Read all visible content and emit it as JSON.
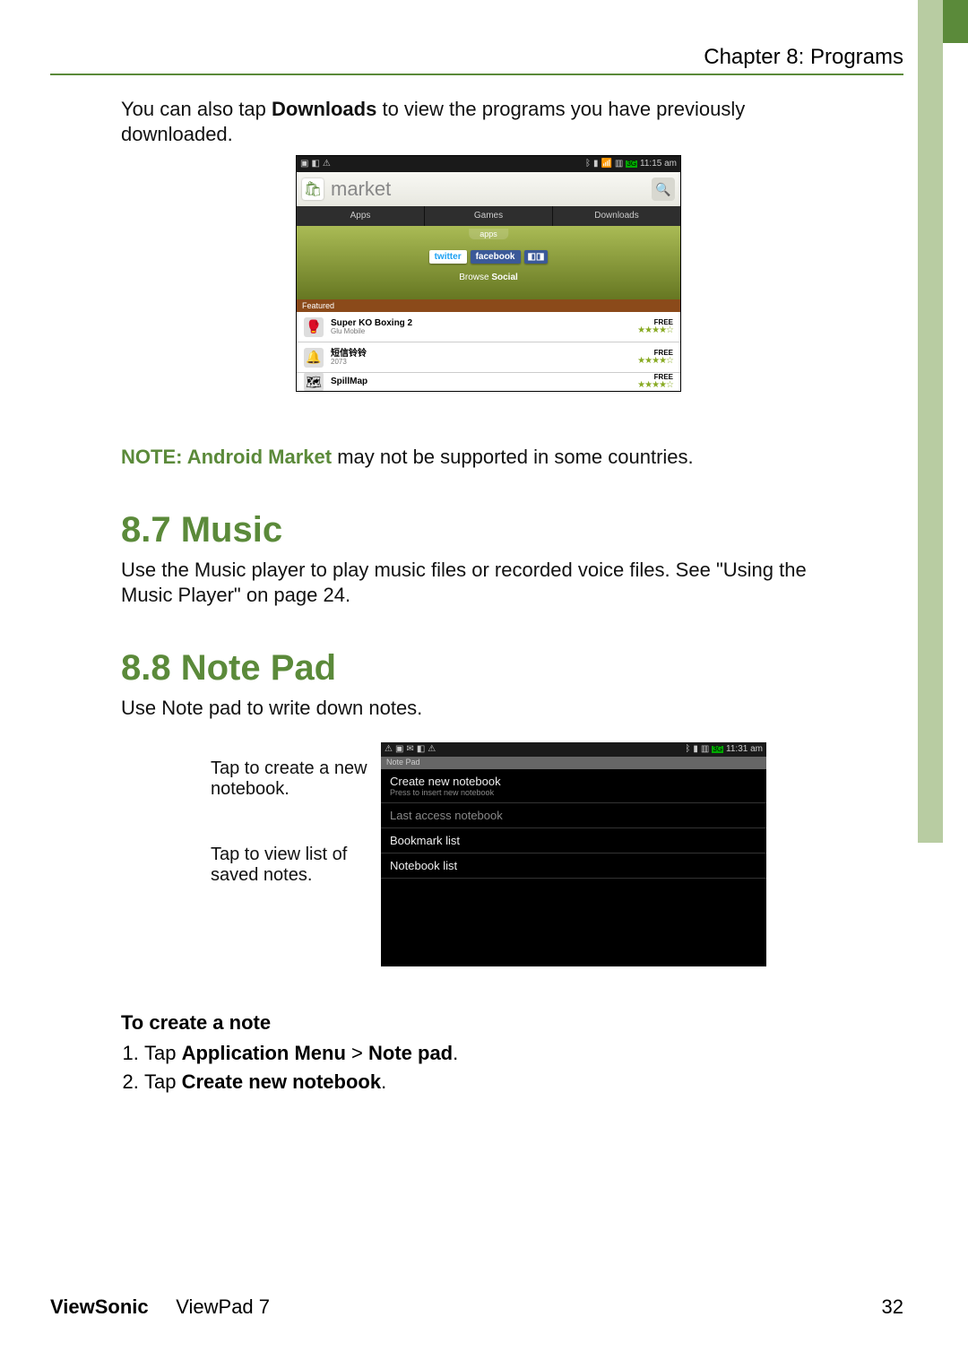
{
  "header": {
    "chapter_label": "Chapter 8: Programs"
  },
  "intro": {
    "text_a": "You can also tap ",
    "text_bold": "Downloads",
    "text_b": " to view the programs you have previously downloaded."
  },
  "market": {
    "status": {
      "time": "11:15 am"
    },
    "title": "market",
    "tabs": [
      "Apps",
      "Games",
      "Downloads"
    ],
    "banner_title": "apps",
    "chips": {
      "twitter": "twitter",
      "facebook": "facebook"
    },
    "browse_prefix": "Browse ",
    "browse_bold": "Social",
    "featured_label": "Featured",
    "rows": [
      {
        "name": "Super KO Boxing 2",
        "pub": "Glu Mobile",
        "price": "FREE",
        "stars": "★★★★☆"
      },
      {
        "name": "短信铃铃",
        "pub": "2073",
        "price": "FREE",
        "stars": "★★★★☆"
      },
      {
        "name": "SpillMap",
        "pub": "",
        "price": "FREE",
        "stars": "★★★★☆"
      }
    ]
  },
  "note_line": {
    "prefix": "NOTE: ",
    "bold": "Android Market",
    "rest": " may not be supported in some countries."
  },
  "music": {
    "heading": "8.7 Music",
    "body": "Use the Music player to play music files or recorded voice files. See \"Using the Music Player\" on page 24."
  },
  "notepad": {
    "heading": "8.8 Note Pad",
    "body": "Use Note pad to write down notes.",
    "callout1": "Tap to create a new notebook.",
    "callout2": "Tap to view list of saved notes.",
    "status_time": "11:31 am",
    "title_bar": "Note Pad",
    "items": [
      {
        "main": "Create new notebook",
        "sub": "Press to insert new notebook",
        "dim": false
      },
      {
        "main": "Last access notebook",
        "sub": "",
        "dim": true
      },
      {
        "main": "Bookmark list",
        "sub": "",
        "dim": false
      },
      {
        "main": "Notebook list",
        "sub": "",
        "dim": false
      }
    ]
  },
  "instructions": {
    "subhead": "To create a note",
    "steps": [
      {
        "pre": "Tap ",
        "bold1": "Application Menu",
        "sep": " > ",
        "bold2": "Note pad",
        "post": "."
      },
      {
        "pre": "Tap ",
        "bold1": "Create new notebook",
        "sep": "",
        "bold2": "",
        "post": "."
      }
    ]
  },
  "footer": {
    "brand": "ViewSonic",
    "model": "ViewPad 7",
    "page": "32"
  }
}
